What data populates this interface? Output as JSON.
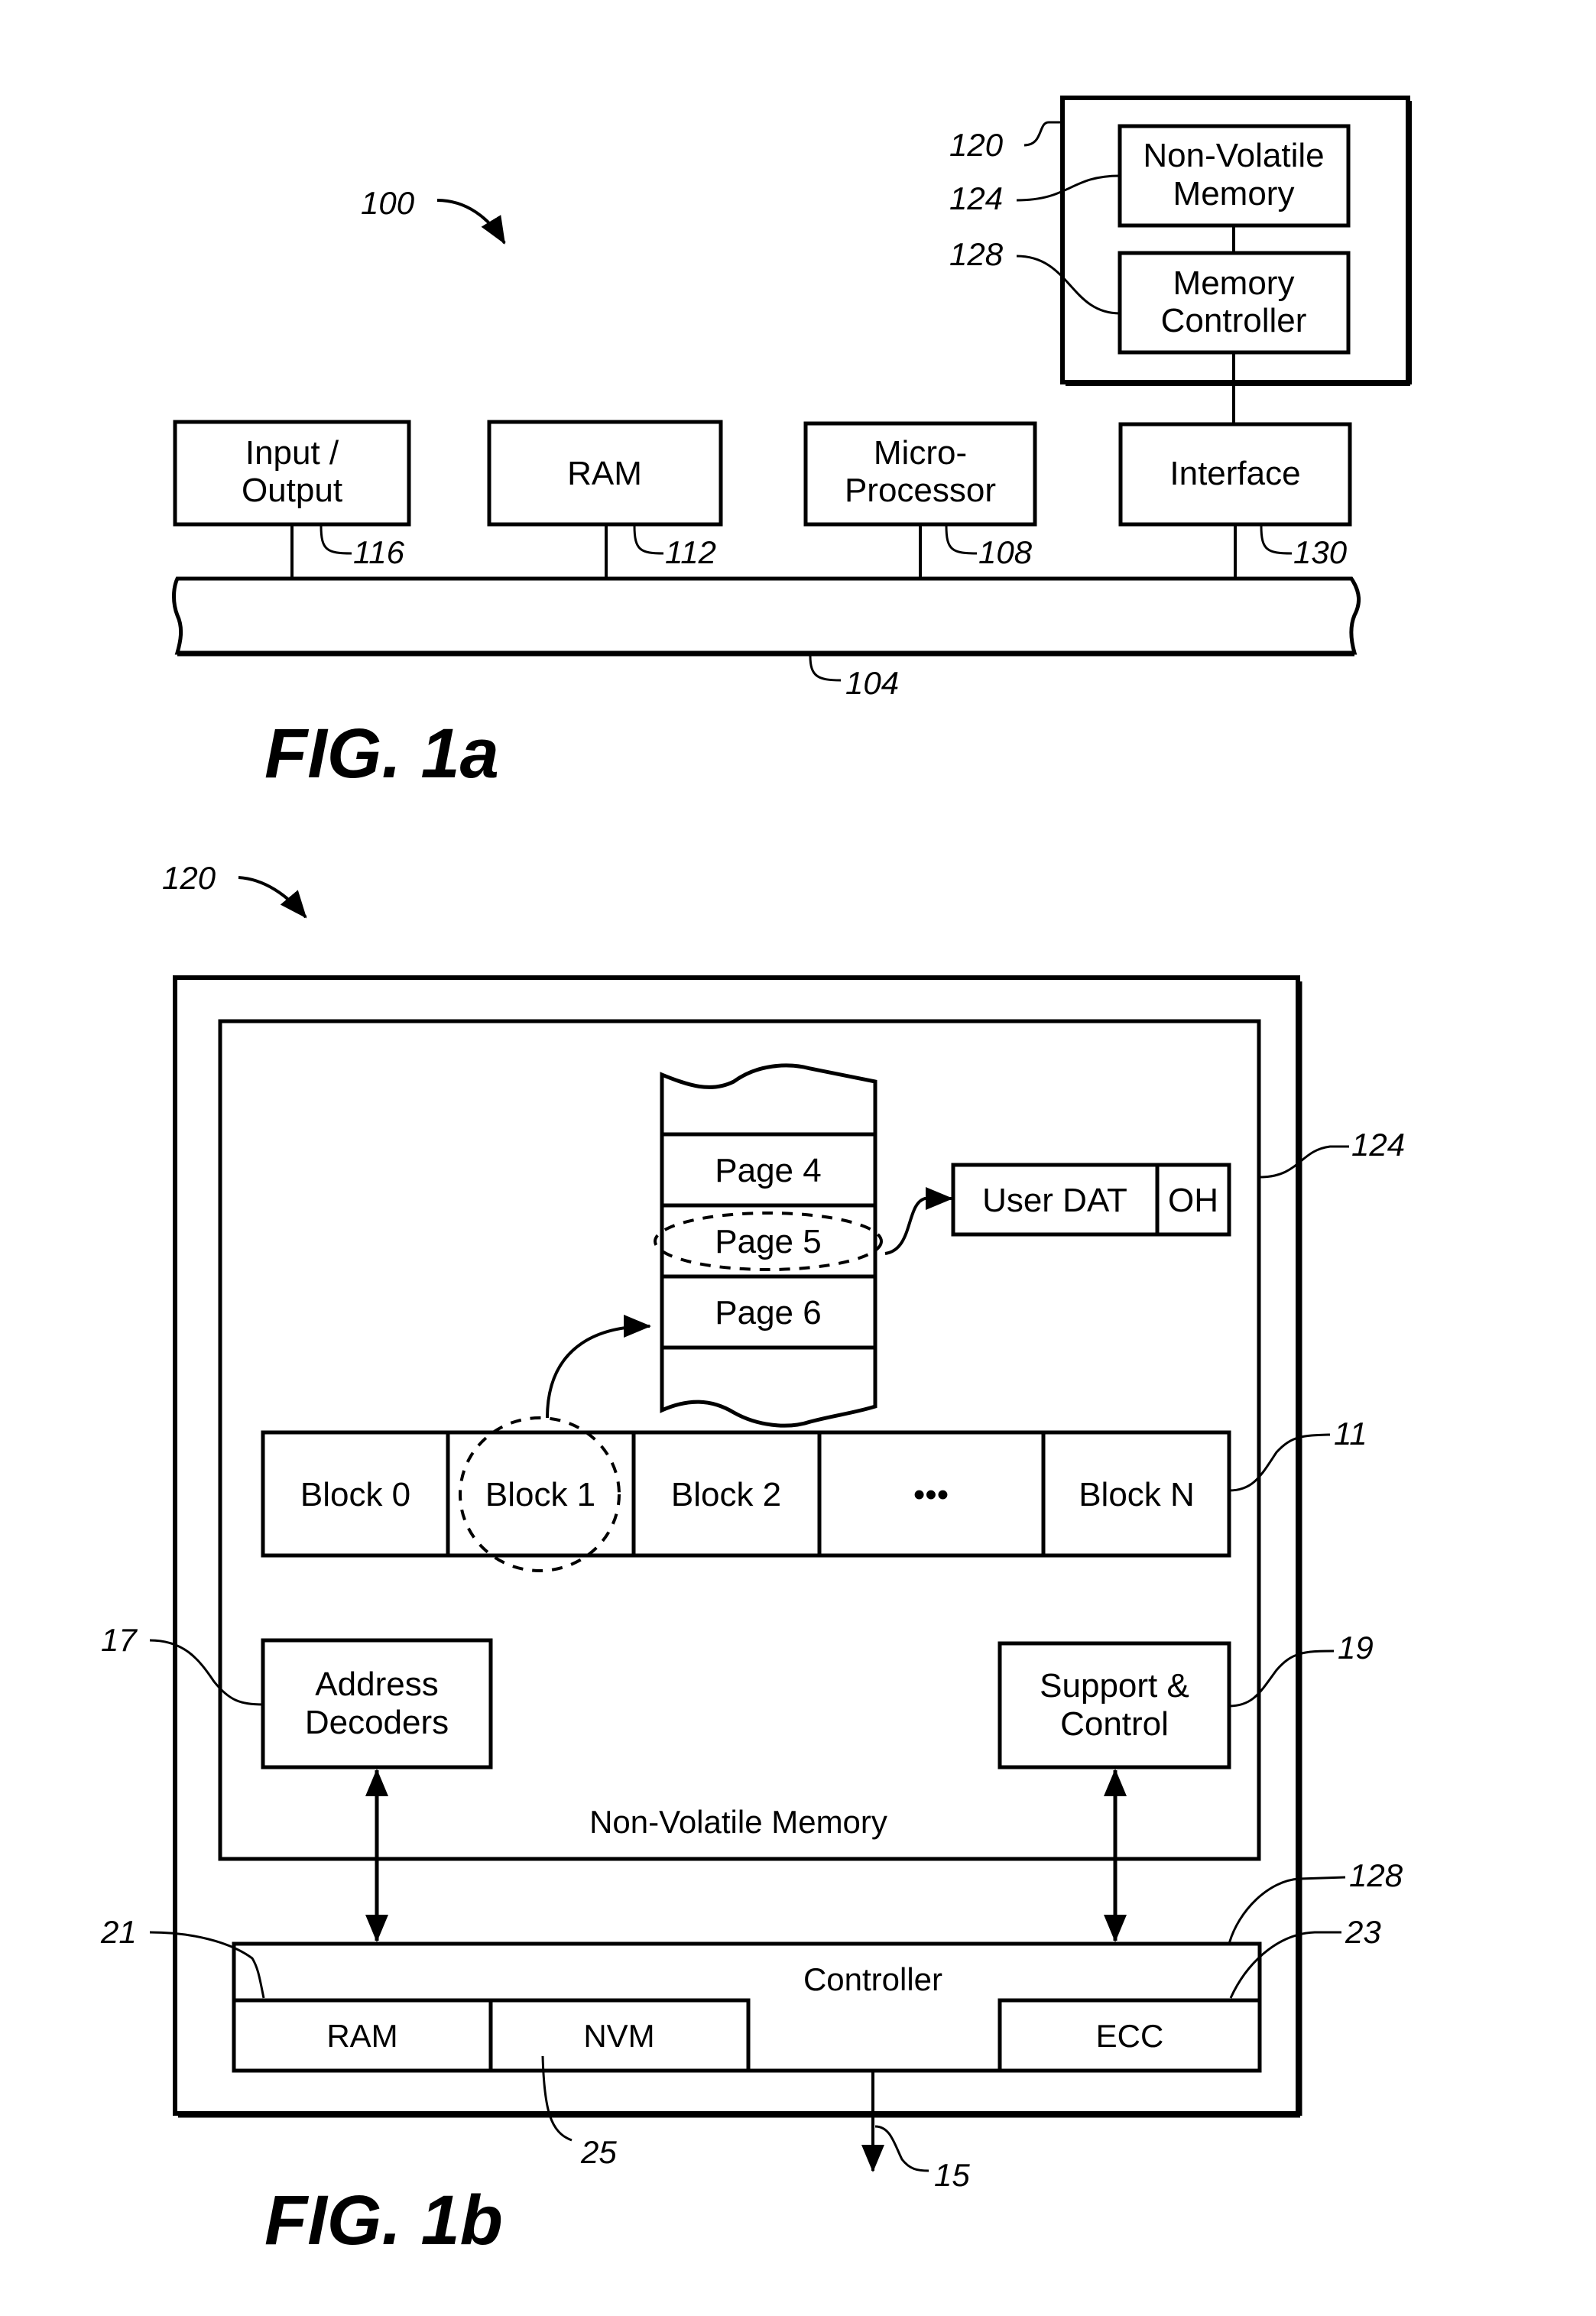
{
  "fig1a": {
    "caption": "FIG. 1a",
    "ref_system": "100",
    "ref_bus": "104",
    "components": [
      {
        "ref": "116",
        "label_line1": "Input /",
        "label_line2": "Output"
      },
      {
        "ref": "112",
        "label_line1": "RAM",
        "label_line2": ""
      },
      {
        "ref": "108",
        "label_line1": "Micro-",
        "label_line2": "Processor"
      },
      {
        "ref": "130",
        "label_line1": "Interface",
        "label_line2": ""
      }
    ],
    "memory_system": {
      "ref": "120",
      "nvm": {
        "ref": "124",
        "label_line1": "Non-Volatile",
        "label_line2": "Memory"
      },
      "controller": {
        "ref": "128",
        "label_line1": "Memory",
        "label_line2": "Controller"
      }
    }
  },
  "fig1b": {
    "caption": "FIG. 1b",
    "ref_system": "120",
    "nvm": {
      "ref": "124",
      "label": "Non-Volatile Memory",
      "pages": [
        "Page 4",
        "Page 5",
        "Page 6"
      ],
      "page_record": {
        "user_data": "User DAT",
        "overhead": "OH"
      },
      "block_array_ref": "11",
      "blocks": [
        "Block 0",
        "Block 1",
        "Block 2",
        "•••",
        "Block N"
      ],
      "address_decoders": {
        "ref": "17",
        "line1": "Address",
        "line2": "Decoders"
      },
      "support_control": {
        "ref": "19",
        "line1": "Support &",
        "line2": "Control"
      }
    },
    "controller": {
      "ref": "128",
      "label": "Controller",
      "ram": {
        "ref": "21",
        "label": "RAM"
      },
      "nvm": {
        "ref": "25",
        "label": "NVM"
      },
      "ecc": {
        "ref": "23",
        "label": "ECC"
      },
      "output_ref": "15"
    }
  }
}
